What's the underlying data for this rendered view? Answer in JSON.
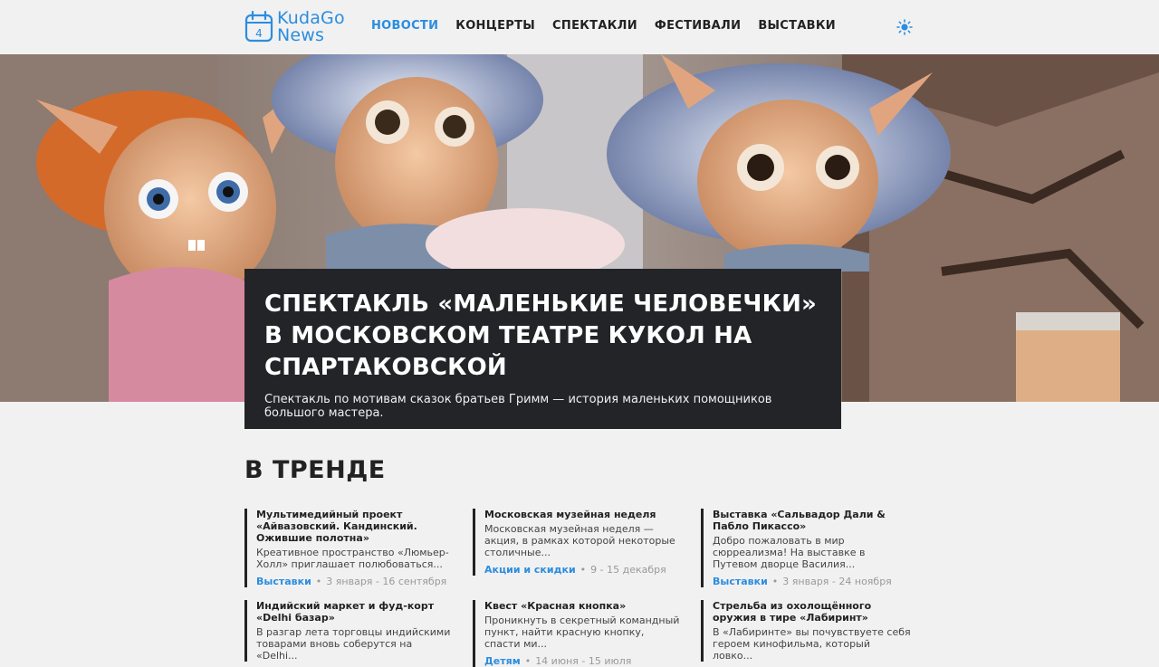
{
  "header": {
    "logo_line1": "KudaGo",
    "logo_line2": "News",
    "logo_day": "4",
    "nav": [
      {
        "label": "НОВОСТИ",
        "active": true
      },
      {
        "label": "КОНЦЕРТЫ",
        "active": false
      },
      {
        "label": "СПЕКТАКЛИ",
        "active": false
      },
      {
        "label": "ФЕСТИВАЛИ",
        "active": false
      },
      {
        "label": "ВЫСТАВКИ",
        "active": false
      }
    ],
    "theme_icon": "sun-icon"
  },
  "hero": {
    "title": "Спектакль «Маленькие человечки» в Московском театре кукол на Спартаковской",
    "subtitle": "Спектакль по мотивам сказок братьев Гримм — история маленьких помощников большого мастера."
  },
  "trending": {
    "title": "В ТРЕНДЕ",
    "items": [
      {
        "title": "Мультимедийный проект «Айвазовский. Кандинский. Ожившие полотна»",
        "text": "Креативное пространство «Люмьер-Холл» приглашает полюбоваться...",
        "category": "Выставки",
        "dates": "3 января - 16 сентября"
      },
      {
        "title": "Московская музейная неделя",
        "text": "Московская музейная неделя — акция, в рамках которой некоторые столичные...",
        "category": "Акции и скидки",
        "dates": "9 - 15 декабря"
      },
      {
        "title": "Выставка «Сальвадор Дали & Пабло Пикассо»",
        "text": "Добро пожаловать в мир сюрреализма! На выставке в Путевом дворце Василия...",
        "category": "Выставки",
        "dates": "3 января - 24 ноября"
      },
      {
        "title": "Индийский маркет и фуд-корт «Delhi базар»",
        "text": "В разгар лета торговцы индийскими товарами вновь соберутся на «Delhi...",
        "category": "",
        "dates": ""
      },
      {
        "title": "Квест «Красная кнопка»",
        "text": "Проникнуть в секретный командный пункт, найти красную кнопку, спасти ми...",
        "category": "Детям",
        "dates": "14 июня - 15 июля"
      },
      {
        "title": "Стрельба из охолощённого оружия в тире «Лабиринт»",
        "text": "В «Лабиринте» вы почувствуете себя героем кинофильма, который ловко...",
        "category": "",
        "dates": ""
      }
    ]
  },
  "colors": {
    "accent": "#2b8de0",
    "dark_card": "#232428",
    "background": "#f1f1f1"
  }
}
